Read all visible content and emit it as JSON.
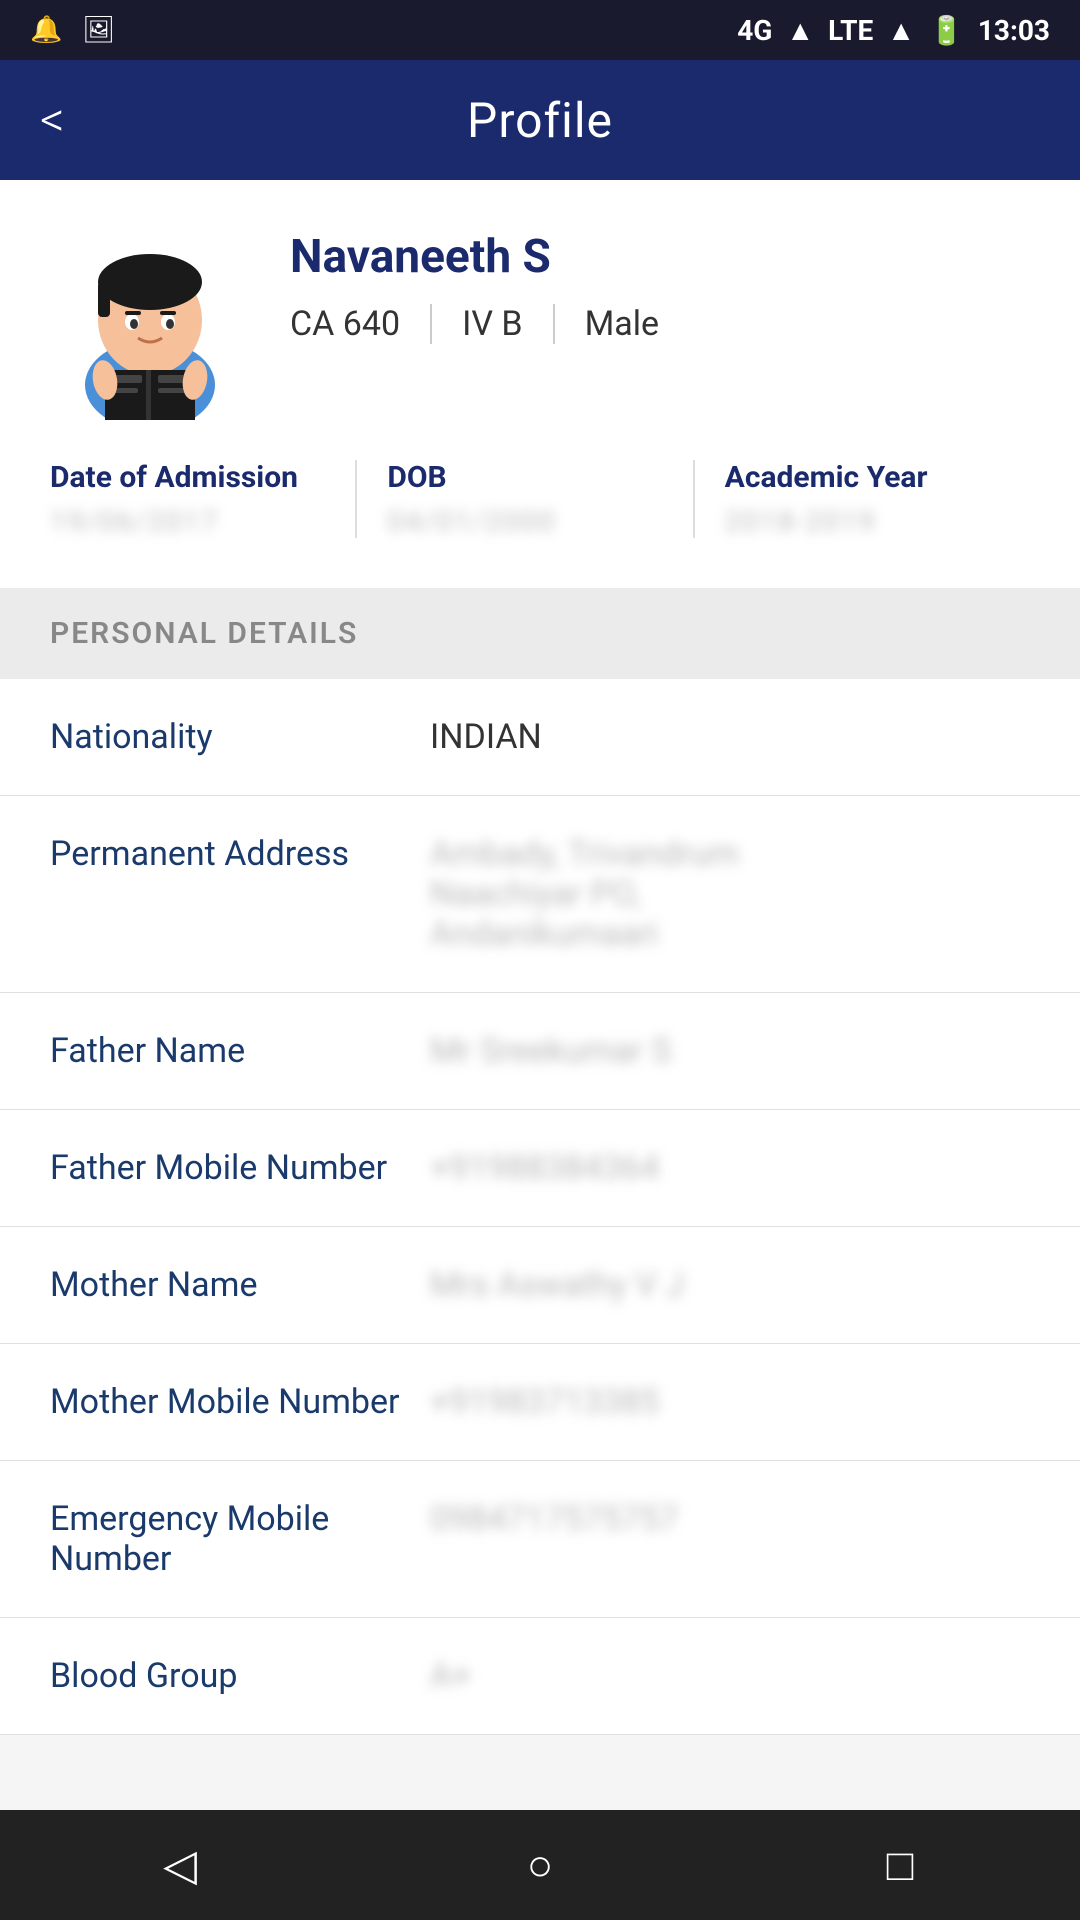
{
  "statusBar": {
    "time": "13:03",
    "signal": "4G",
    "lte": "LTE",
    "battery": "100"
  },
  "appBar": {
    "title": "Profile",
    "backLabel": "<"
  },
  "profile": {
    "name": "Navaneeth S",
    "rollNumber": "CA 640",
    "section": "IV B",
    "gender": "Male",
    "admissionLabel": "Date of Admission",
    "admissionValue": "19/06/2017",
    "dobLabel": "DOB",
    "dobValue": "04/01/2000",
    "academicYearLabel": "Academic Year",
    "academicYearValue": "2018-2019"
  },
  "sections": {
    "personalDetails": {
      "header": "PERSONAL DETAILS",
      "fields": [
        {
          "label": "Nationality",
          "value": "INDIAN",
          "blurred": false
        },
        {
          "label": "Permanent Address",
          "value": "Ambady, Trivandrum\nNaachiyar PO,\nAndanikumaari",
          "blurred": true
        },
        {
          "label": "Father Name",
          "value": "Mr Sreekumar S",
          "blurred": true
        },
        {
          "label": "Father Mobile Number",
          "value": "+91988384364",
          "blurred": true
        },
        {
          "label": "Mother Name",
          "value": "Mrs Aswathy V J",
          "blurred": true
        },
        {
          "label": "Mother Mobile Number",
          "value": "+91983713385",
          "blurred": true
        },
        {
          "label": "Emergency Mobile Number",
          "value": "0984717575757",
          "blurred": true
        },
        {
          "label": "Blood Group",
          "value": "A+",
          "blurred": true
        }
      ]
    }
  },
  "bottomNav": {
    "backIcon": "◁",
    "homeIcon": "○",
    "recentIcon": "□"
  }
}
